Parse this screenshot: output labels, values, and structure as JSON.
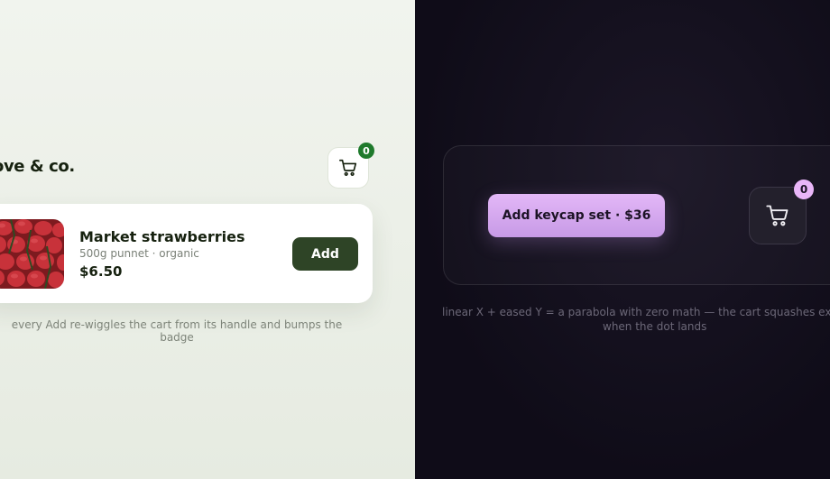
{
  "light_demo": {
    "store_name": "ove & co.",
    "cart_count": "0",
    "product": {
      "title": "Market strawberries",
      "meta": "500g punnet · organic",
      "price": "$6.50",
      "image": "strawberries-photo"
    },
    "add_label": "Add",
    "caption": "every Add re-wiggles the cart from its handle and bumps the badge",
    "colors": {
      "accent": "#2e4426",
      "badge": "#1f7a2c"
    }
  },
  "dark_demo": {
    "button_label": "Add keycap set · $36",
    "cart_count": "0",
    "caption_line1": "linear X + eased Y = a parabola with zero math — the cart squashes exa",
    "caption_line2": "when the dot lands",
    "colors": {
      "accent": "#e3b7f7",
      "background": "#0f0c18"
    }
  },
  "icons": [
    "cart-icon"
  ]
}
